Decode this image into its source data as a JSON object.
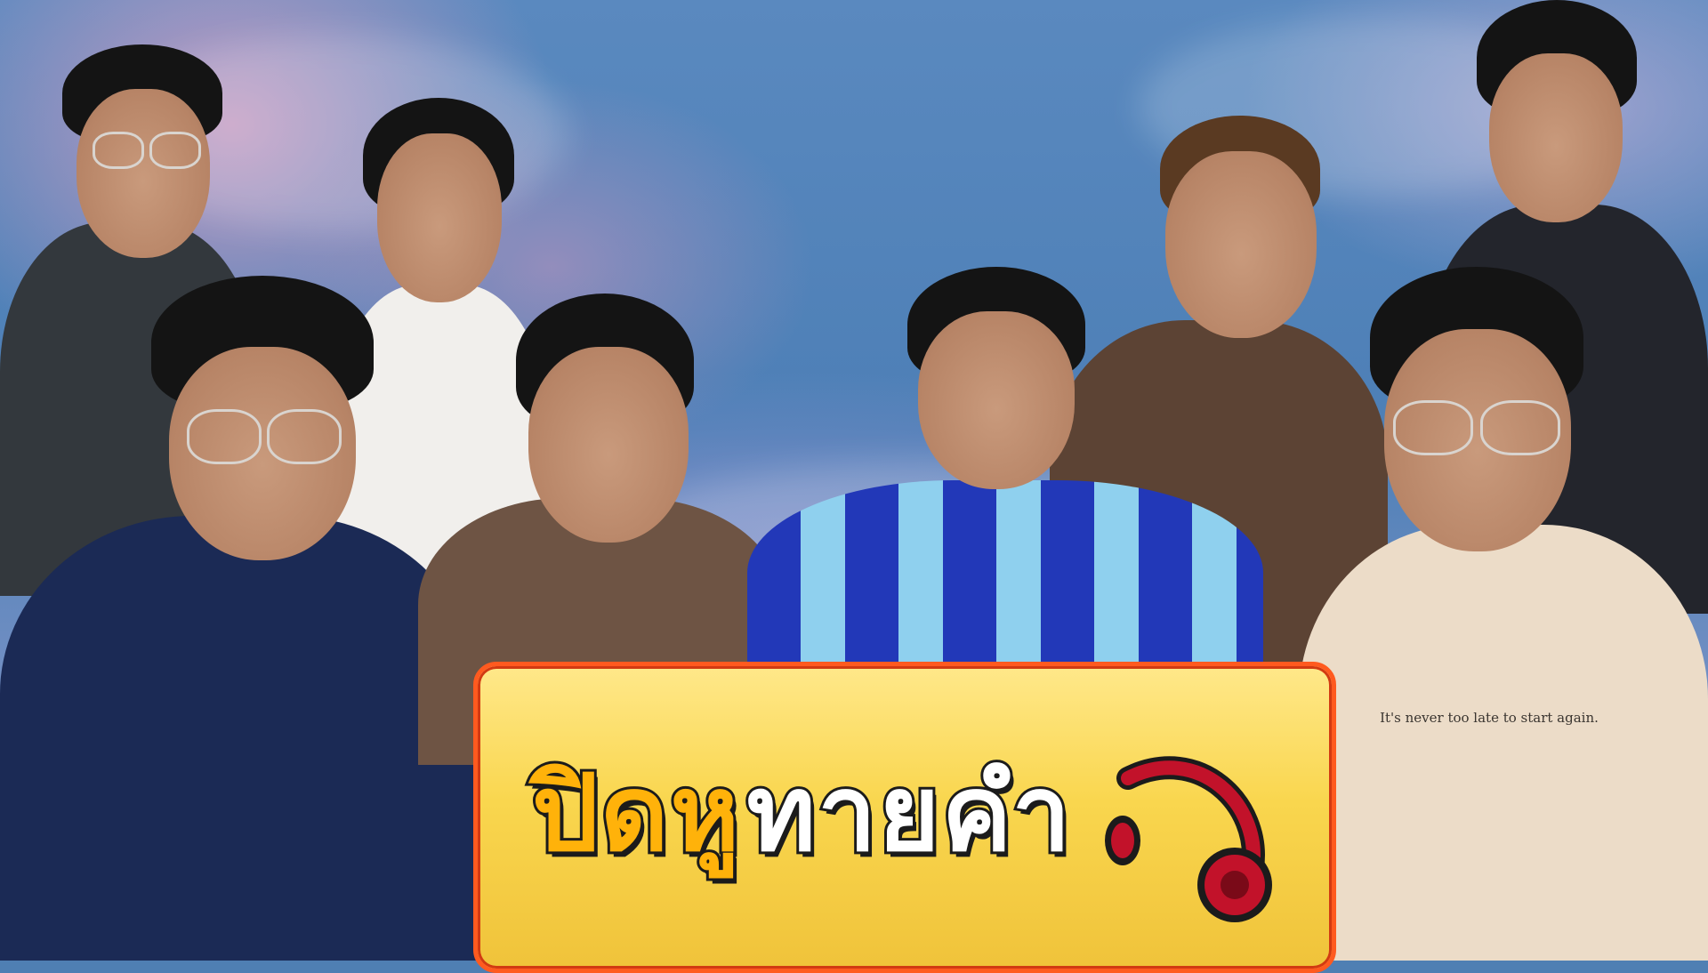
{
  "title": {
    "part1": "ปิดหู",
    "part2": "ทายคำ"
  },
  "shirt_print": "It's never too late to start again.",
  "colors": {
    "banner": "#f9d64e",
    "banner_border": "#ff5a1f",
    "title_highlight": "#ffb20a",
    "title_main": "#ffffff",
    "outline": "#1b1b1b",
    "headphone": "#c2122a"
  },
  "icons": {
    "decoration": "headphone-icon"
  }
}
